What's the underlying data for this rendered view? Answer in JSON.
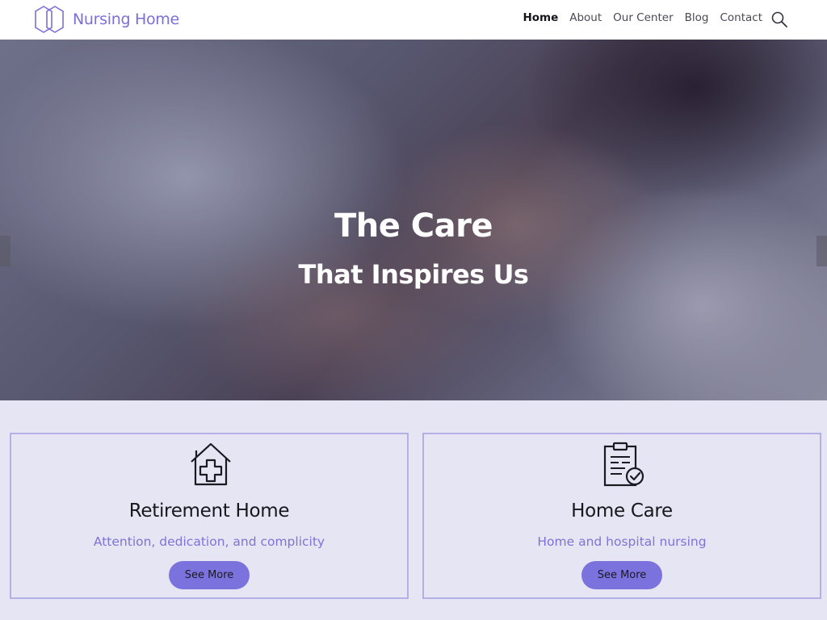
{
  "brand": {
    "name": "Nursing Home",
    "logo_icon": "hexagon-logo-icon",
    "accent_color": "#7b6fd8"
  },
  "nav": {
    "items": [
      {
        "label": "Home",
        "active": true
      },
      {
        "label": "About",
        "active": false
      },
      {
        "label": "Our Center",
        "active": false
      },
      {
        "label": "Blog",
        "active": false
      },
      {
        "label": "Contact",
        "active": false
      }
    ],
    "search_icon": "search-icon"
  },
  "hero": {
    "title": "The Care",
    "subtitle": "That Inspires Us",
    "prev_icon": "slider-prev-arrow",
    "next_icon": "slider-next-arrow"
  },
  "services": [
    {
      "icon": "house-medical-icon",
      "title": "Retirement Home",
      "description": "Attention, dedication, and complicity",
      "button": "See More"
    },
    {
      "icon": "clipboard-check-icon",
      "title": "Home Care",
      "description": "Home and hospital nursing",
      "button": "See More"
    }
  ],
  "colors": {
    "services_background": "#e6e5f3",
    "card_border": "#b3b0e6",
    "button": "#7c72dd",
    "description": "#7e73d6"
  }
}
